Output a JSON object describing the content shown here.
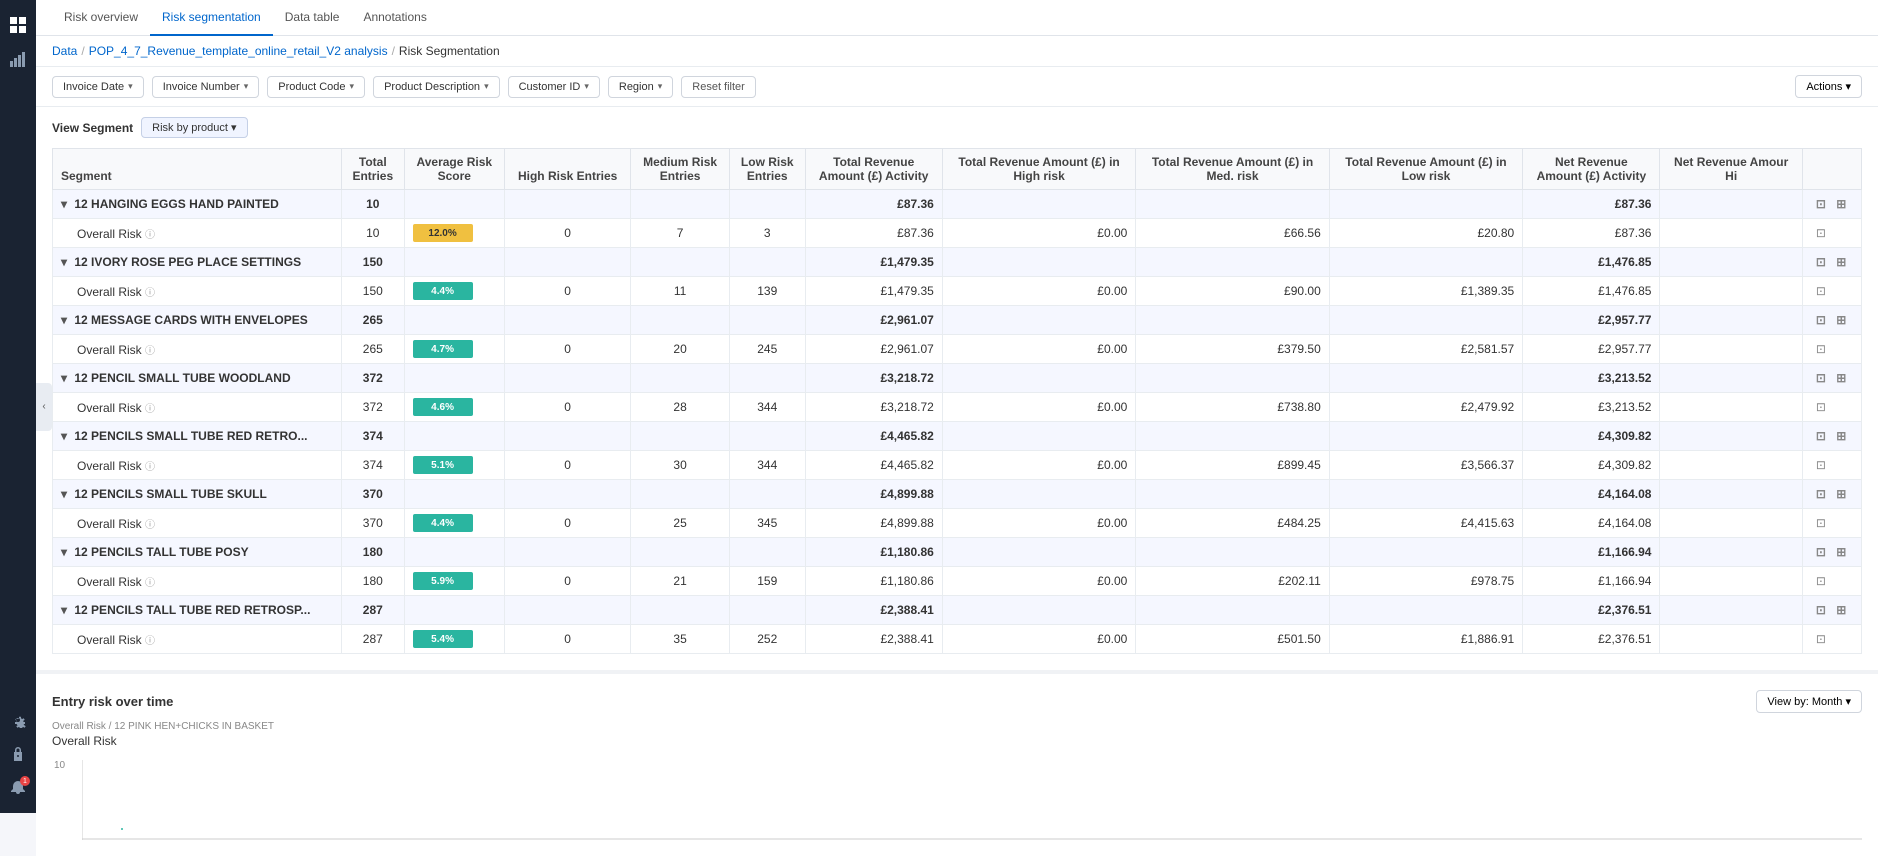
{
  "nav": {
    "tabs": [
      {
        "label": "Risk overview",
        "active": false
      },
      {
        "label": "Risk segmentation",
        "active": true
      },
      {
        "label": "Data table",
        "active": false
      },
      {
        "label": "Annotations",
        "active": false
      }
    ]
  },
  "breadcrumb": {
    "items": [
      "Data",
      "POP_4_7_Revenue_template_online_retail_V2 analysis",
      "Risk Segmentation"
    ]
  },
  "filters": {
    "buttons": [
      {
        "label": "Invoice Date",
        "id": "invoice-date"
      },
      {
        "label": "Invoice Number",
        "id": "invoice-number"
      },
      {
        "label": "Product Code",
        "id": "product-code"
      },
      {
        "label": "Product Description",
        "id": "product-desc"
      },
      {
        "label": "Customer ID",
        "id": "customer-id"
      },
      {
        "label": "Region",
        "id": "region"
      }
    ],
    "reset_label": "Reset filter",
    "actions_label": "Actions ▾"
  },
  "view_segment": {
    "label": "View Segment",
    "type_label": "Risk by product ▾"
  },
  "table": {
    "columns": [
      "Segment",
      "Total Entries",
      "Average Risk Score",
      "High Risk Entries",
      "Medium Risk Entries",
      "Low Risk Entries",
      "Total Revenue Amount (£) Activity",
      "Total Revenue Amount (£) in High risk",
      "Total Revenue Amount (£) in Med. risk",
      "Total Revenue Amount (£) in Low risk",
      "Net Revenue Amount (£) Activity",
      "Net Revenue Amour Hi"
    ],
    "rows": [
      {
        "type": "segment",
        "name": "12 HANGING EGGS HAND PAINTED",
        "total_entries": "10",
        "avg_risk": "",
        "high_risk": "",
        "med_risk": "",
        "low_risk": "",
        "total_rev": "£87.36",
        "high_rev": "",
        "med_rev": "",
        "low_rev": "",
        "net_rev": "£87.36",
        "net_high": ""
      },
      {
        "type": "risk",
        "name": "Overall Risk",
        "total_entries": "10",
        "avg_risk": "12.0%",
        "risk_color": "yellow",
        "high_risk": "0",
        "med_risk": "7",
        "low_risk": "3",
        "total_rev": "£87.36",
        "high_rev": "£0.00",
        "med_rev": "£66.56",
        "low_rev": "£20.80",
        "net_rev": "£87.36",
        "net_high": ""
      },
      {
        "type": "segment",
        "name": "12 IVORY ROSE PEG PLACE SETTINGS",
        "total_entries": "150",
        "avg_risk": "",
        "high_risk": "",
        "med_risk": "",
        "low_risk": "",
        "total_rev": "£1,479.35",
        "high_rev": "",
        "med_rev": "",
        "low_rev": "",
        "net_rev": "£1,476.85",
        "net_high": ""
      },
      {
        "type": "risk",
        "name": "Overall Risk",
        "total_entries": "150",
        "avg_risk": "4.4%",
        "risk_color": "teal",
        "high_risk": "0",
        "med_risk": "11",
        "low_risk": "139",
        "total_rev": "£1,479.35",
        "high_rev": "£0.00",
        "med_rev": "£90.00",
        "low_rev": "£1,389.35",
        "net_rev": "£1,476.85",
        "net_high": ""
      },
      {
        "type": "segment",
        "name": "12 MESSAGE CARDS WITH ENVELOPES",
        "total_entries": "265",
        "avg_risk": "",
        "high_risk": "",
        "med_risk": "",
        "low_risk": "",
        "total_rev": "£2,961.07",
        "high_rev": "",
        "med_rev": "",
        "low_rev": "",
        "net_rev": "£2,957.77",
        "net_high": ""
      },
      {
        "type": "risk",
        "name": "Overall Risk",
        "total_entries": "265",
        "avg_risk": "4.7%",
        "risk_color": "teal",
        "high_risk": "0",
        "med_risk": "20",
        "low_risk": "245",
        "total_rev": "£2,961.07",
        "high_rev": "£0.00",
        "med_rev": "£379.50",
        "low_rev": "£2,581.57",
        "net_rev": "£2,957.77",
        "net_high": ""
      },
      {
        "type": "segment",
        "name": "12 PENCIL SMALL TUBE WOODLAND",
        "total_entries": "372",
        "avg_risk": "",
        "high_risk": "",
        "med_risk": "",
        "low_risk": "",
        "total_rev": "£3,218.72",
        "high_rev": "",
        "med_rev": "",
        "low_rev": "",
        "net_rev": "£3,213.52",
        "net_high": ""
      },
      {
        "type": "risk",
        "name": "Overall Risk",
        "total_entries": "372",
        "avg_risk": "4.6%",
        "risk_color": "teal",
        "high_risk": "0",
        "med_risk": "28",
        "low_risk": "344",
        "total_rev": "£3,218.72",
        "high_rev": "£0.00",
        "med_rev": "£738.80",
        "low_rev": "£2,479.92",
        "net_rev": "£3,213.52",
        "net_high": ""
      },
      {
        "type": "segment",
        "name": "12 PENCILS SMALL TUBE RED RETRO...",
        "total_entries": "374",
        "avg_risk": "",
        "high_risk": "",
        "med_risk": "",
        "low_risk": "",
        "total_rev": "£4,465.82",
        "high_rev": "",
        "med_rev": "",
        "low_rev": "",
        "net_rev": "£4,309.82",
        "net_high": ""
      },
      {
        "type": "risk",
        "name": "Overall Risk",
        "total_entries": "374",
        "avg_risk": "5.1%",
        "risk_color": "teal",
        "high_risk": "0",
        "med_risk": "30",
        "low_risk": "344",
        "total_rev": "£4,465.82",
        "high_rev": "£0.00",
        "med_rev": "£899.45",
        "low_rev": "£3,566.37",
        "net_rev": "£4,309.82",
        "net_high": ""
      },
      {
        "type": "segment",
        "name": "12 PENCILS SMALL TUBE SKULL",
        "total_entries": "370",
        "avg_risk": "",
        "high_risk": "",
        "med_risk": "",
        "low_risk": "",
        "total_rev": "£4,899.88",
        "high_rev": "",
        "med_rev": "",
        "low_rev": "",
        "net_rev": "£4,164.08",
        "net_high": ""
      },
      {
        "type": "risk",
        "name": "Overall Risk",
        "total_entries": "370",
        "avg_risk": "4.4%",
        "risk_color": "teal",
        "high_risk": "0",
        "med_risk": "25",
        "low_risk": "345",
        "total_rev": "£4,899.88",
        "high_rev": "£0.00",
        "med_rev": "£484.25",
        "low_rev": "£4,415.63",
        "net_rev": "£4,164.08",
        "net_high": ""
      },
      {
        "type": "segment",
        "name": "12 PENCILS TALL TUBE POSY",
        "total_entries": "180",
        "avg_risk": "",
        "high_risk": "",
        "med_risk": "",
        "low_risk": "",
        "total_rev": "£1,180.86",
        "high_rev": "",
        "med_rev": "",
        "low_rev": "",
        "net_rev": "£1,166.94",
        "net_high": ""
      },
      {
        "type": "risk",
        "name": "Overall Risk",
        "total_entries": "180",
        "avg_risk": "5.9%",
        "risk_color": "teal",
        "high_risk": "0",
        "med_risk": "21",
        "low_risk": "159",
        "total_rev": "£1,180.86",
        "high_rev": "£0.00",
        "med_rev": "£202.11",
        "low_rev": "£978.75",
        "net_rev": "£1,166.94",
        "net_high": ""
      },
      {
        "type": "segment",
        "name": "12 PENCILS TALL TUBE RED RETROSP...",
        "total_entries": "287",
        "avg_risk": "",
        "high_risk": "",
        "med_risk": "",
        "low_risk": "",
        "total_rev": "£2,388.41",
        "high_rev": "",
        "med_rev": "",
        "low_rev": "",
        "net_rev": "£2,376.51",
        "net_high": ""
      },
      {
        "type": "risk",
        "name": "Overall Risk",
        "total_entries": "287",
        "avg_risk": "5.4%",
        "risk_color": "teal",
        "high_risk": "0",
        "med_risk": "35",
        "low_risk": "252",
        "total_rev": "£2,388.41",
        "high_rev": "£0.00",
        "med_rev": "£501.50",
        "low_rev": "£1,886.91",
        "net_rev": "£2,376.51",
        "net_high": ""
      }
    ]
  },
  "chart": {
    "title": "Entry risk over time",
    "view_by_label": "View by: Month ▾",
    "breadcrumb": "Overall Risk / 12 PINK HEN+CHICKS IN BASKET",
    "subtitle": "Overall Risk",
    "y_axis_label": "10"
  },
  "sidebar": {
    "icons": [
      {
        "name": "grid-icon",
        "symbol": "⊞"
      },
      {
        "name": "chart-icon",
        "symbol": "📊"
      },
      {
        "name": "settings-icon",
        "symbol": "⚙"
      },
      {
        "name": "lock-icon",
        "symbol": "🔒"
      },
      {
        "name": "search-icon",
        "symbol": "🔍"
      },
      {
        "name": "bell-icon",
        "symbol": "🔔"
      }
    ]
  }
}
